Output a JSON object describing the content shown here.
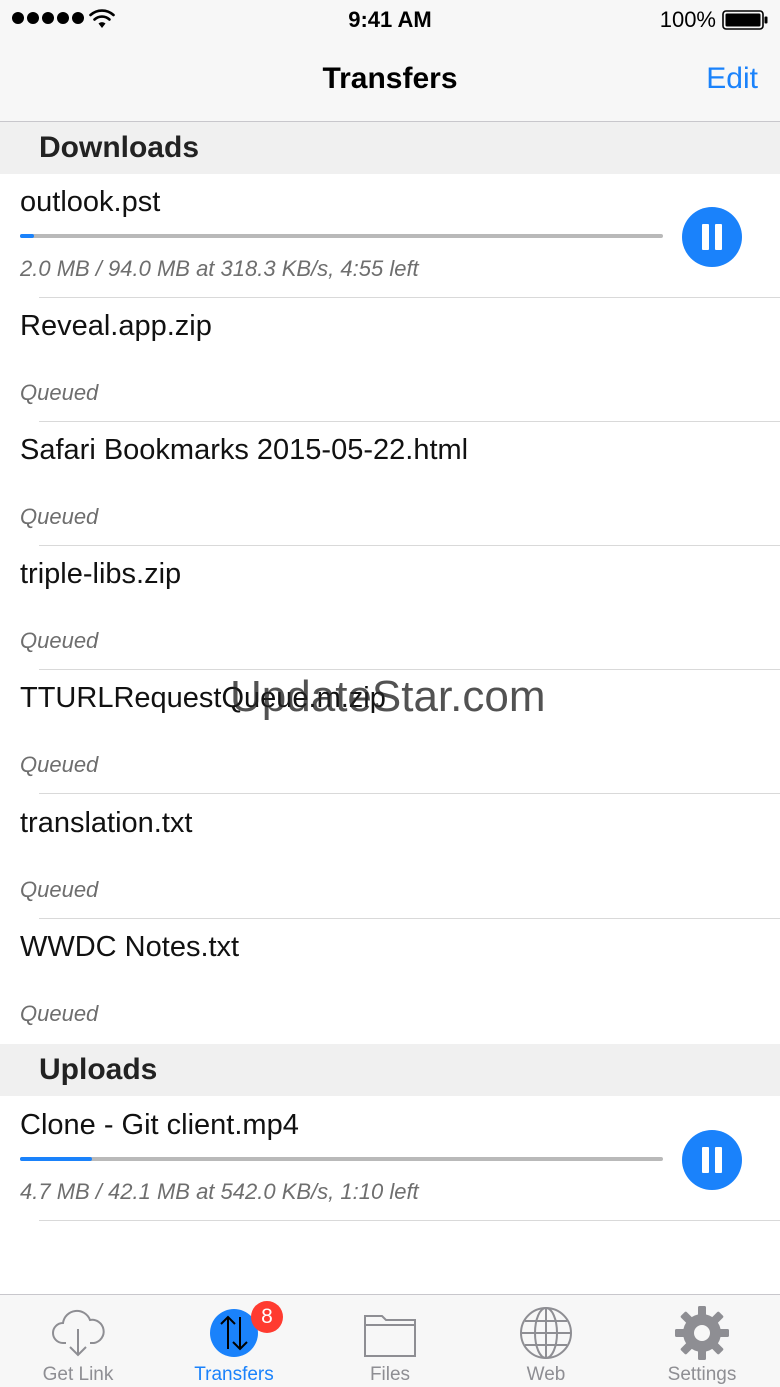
{
  "status_bar": {
    "time": "9:41 AM",
    "battery_percent": "100%",
    "signal_icon": "signal-dots-icon",
    "wifi_icon": "wifi-icon",
    "battery_icon": "battery-icon"
  },
  "nav": {
    "title": "Transfers",
    "edit_label": "Edit"
  },
  "colors": {
    "accent": "#1a82fb",
    "badge": "#ff3b30",
    "section_bg": "#f0f0f0"
  },
  "downloads": {
    "header": "Downloads",
    "items": [
      {
        "name": "outlook.pst",
        "status": "2.0 MB / 94.0 MB at 318.3 KB/s, 4:55 left",
        "progress": 0.021,
        "active": true
      },
      {
        "name": "Reveal.app.zip",
        "status": "Queued",
        "active": false
      },
      {
        "name": "Safari Bookmarks 2015-05-22.html",
        "status": "Queued",
        "active": false
      },
      {
        "name": "triple-libs.zip",
        "status": "Queued",
        "active": false
      },
      {
        "name": "TTURLRequestQueue.m.zip",
        "status": "Queued",
        "active": false
      },
      {
        "name": "translation.txt",
        "status": "Queued",
        "active": false
      },
      {
        "name": "WWDC Notes.txt",
        "status": "Queued",
        "active": false
      }
    ]
  },
  "uploads": {
    "header": "Uploads",
    "items": [
      {
        "name": "Clone - Git client.mp4",
        "status": "4.7 MB / 42.1 MB at 542.0 KB/s, 1:10 left",
        "progress": 0.112,
        "active": true
      }
    ]
  },
  "watermark": "UpdateStar.com",
  "tabs": [
    {
      "label": "Get Link",
      "icon": "cloud-download-icon",
      "active": false
    },
    {
      "label": "Transfers",
      "icon": "transfers-icon",
      "active": true,
      "badge": "8"
    },
    {
      "label": "Files",
      "icon": "folder-icon",
      "active": false
    },
    {
      "label": "Web",
      "icon": "globe-icon",
      "active": false
    },
    {
      "label": "Settings",
      "icon": "gear-icon",
      "active": false
    }
  ]
}
